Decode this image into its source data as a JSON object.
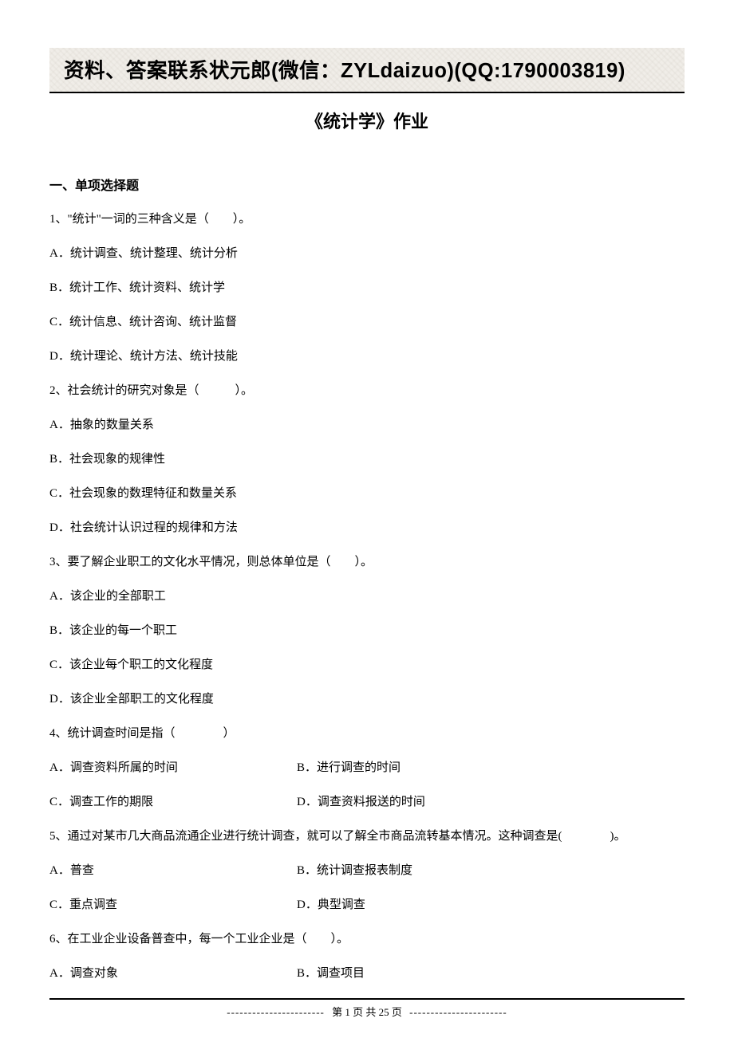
{
  "header": {
    "banner": "资料、答案联系状元郎(微信：ZYLdaizuo)(QQ:1790003819)"
  },
  "title": "《统计学》作业",
  "section1": {
    "heading": "一、单项选择题",
    "q1": {
      "stem": "1、\"统计\"一词的三种含义是（　　）。",
      "a": "A．统计调查、统计整理、统计分析",
      "b": "B．统计工作、统计资料、统计学",
      "c": "C．统计信息、统计咨询、统计监督",
      "d": "D．统计理论、统计方法、统计技能"
    },
    "q2": {
      "stem": "2、社会统计的研究对象是（　　　）。",
      "a": "A．抽象的数量关系",
      "b": "B．社会现象的规律性",
      "c": "C．社会现象的数理特征和数量关系",
      "d": "D．社会统计认识过程的规律和方法"
    },
    "q3": {
      "stem": "3、要了解企业职工的文化水平情况，则总体单位是（　　）。",
      "a": "A．该企业的全部职工",
      "b": "B．该企业的每一个职工",
      "c": "C．该企业每个职工的文化程度",
      "d": "D．该企业全部职工的文化程度"
    },
    "q4": {
      "stem": "4、统计调查时间是指（　　　　）",
      "a": "A．调查资料所属的时间",
      "b": "B．进行调查的时间",
      "c": "C．调查工作的期限",
      "d": "D．调查资料报送的时间"
    },
    "q5": {
      "stem": "5、通过对某市几大商品流通企业进行统计调查，就可以了解全市商品流转基本情况。这种调查是(　　　　)。",
      "a": "A．普查",
      "b": "B．统计调查报表制度",
      "c": "C．重点调查",
      "d": "D．典型调查"
    },
    "q6": {
      "stem": "6、在工业企业设备普查中，每一个工业企业是（　　）。",
      "a": "A．调查对象",
      "b": "B．调查项目"
    }
  },
  "footer": {
    "dash_left": "-----------------------",
    "text": "第 1 页 共 25 页",
    "dash_right": "-----------------------"
  }
}
